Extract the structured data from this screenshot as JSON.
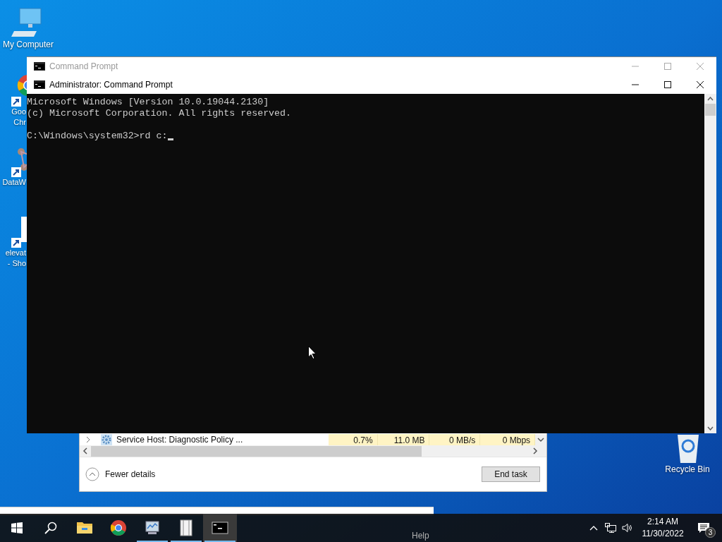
{
  "desktop_icons": [
    {
      "kind": "computer",
      "lines": [
        "My Computer"
      ]
    },
    {
      "kind": "chrome",
      "lines": [
        "Goo",
        "Chr"
      ]
    },
    {
      "kind": "molecule",
      "lines": [
        "DataW"
      ]
    },
    {
      "kind": "document",
      "lines": [
        "elevat",
        "- Sho"
      ]
    },
    {
      "kind": "recycle",
      "lines": [
        "Recycle Bin"
      ]
    }
  ],
  "back_window": {
    "title": "Command Prompt",
    "active": false
  },
  "front_window": {
    "title": "Administrator: Command Prompt",
    "active": true,
    "console_blocks": [
      [
        "Microsoft Windows [Version 10.0.19044.2130]",
        "(c) Microsoft Corporation. All rights reserved."
      ],
      [
        "C:\\Windows\\system32>rd c:"
      ]
    ],
    "cursor": true
  },
  "task_manager": {
    "row": {
      "name": "Service Host: Diagnostic Policy ...",
      "cells": [
        "0.7%",
        "11.0 MB",
        "0 MB/s",
        "0 Mbps"
      ]
    },
    "fewer_details": "Fewer details",
    "end_task": "End task"
  },
  "hidden_window": {
    "menu_item": "Help"
  },
  "taskbar": {
    "apps": [
      {
        "kind": "explorer",
        "running": false,
        "selected": false
      },
      {
        "kind": "chrome",
        "running": false,
        "selected": false
      },
      {
        "kind": "monitor",
        "running": true,
        "selected": false
      },
      {
        "kind": "notebook",
        "running": true,
        "selected": false
      },
      {
        "kind": "console",
        "running": true,
        "selected": true
      }
    ],
    "time": "2:14 AM",
    "date": "11/30/2022",
    "notifications": "3"
  }
}
